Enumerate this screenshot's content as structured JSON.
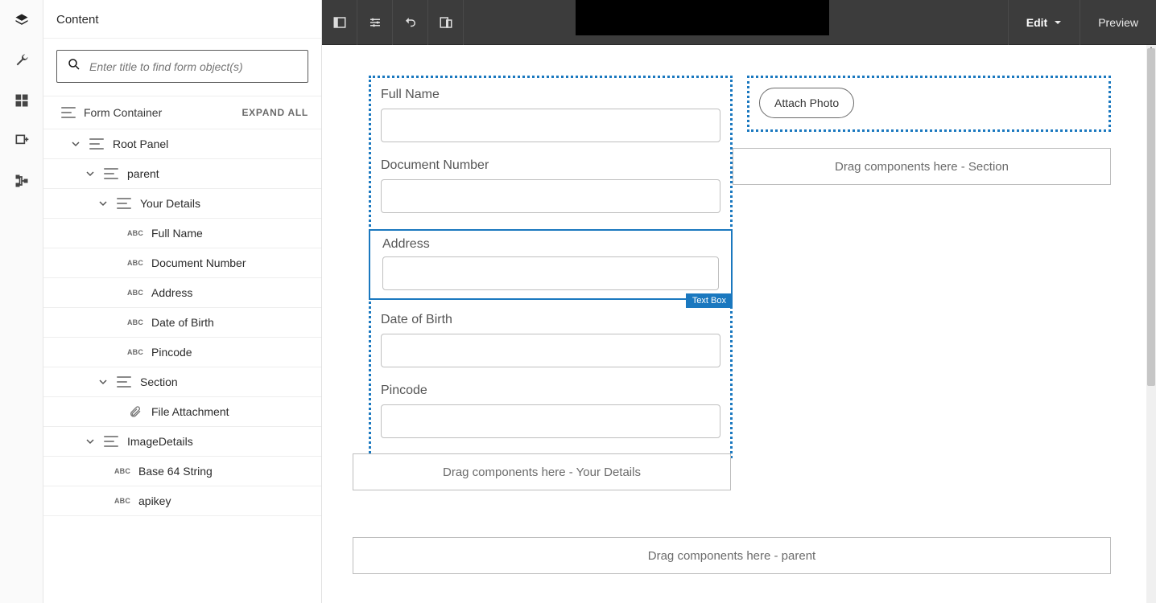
{
  "panel": {
    "title": "Content",
    "search_placeholder": "Enter title to find form object(s)",
    "root_label": "Form Container",
    "expand_all": "EXPAND ALL"
  },
  "tree": {
    "root_panel": "Root Panel",
    "parent": "parent",
    "your_details": "Your Details",
    "full_name": "Full Name",
    "document_number": "Document Number",
    "address": "Address",
    "dob": "Date of Birth",
    "pincode": "Pincode",
    "section": "Section",
    "file_attachment": "File Attachment",
    "image_details": "ImageDetails",
    "base64": "Base 64 String",
    "apikey": "apikey"
  },
  "toolbar": {
    "edit": "Edit",
    "preview": "Preview"
  },
  "form": {
    "fields": {
      "full_name": "Full Name",
      "document_number": "Document Number",
      "address": "Address",
      "dob": "Date of Birth",
      "pincode": "Pincode"
    },
    "selected_tag": "Text Box",
    "attach_photo": "Attach Photo",
    "drop_your_details": "Drag components here - Your Details",
    "drop_section": "Drag components here - Section",
    "drop_parent": "Drag components here - parent"
  }
}
